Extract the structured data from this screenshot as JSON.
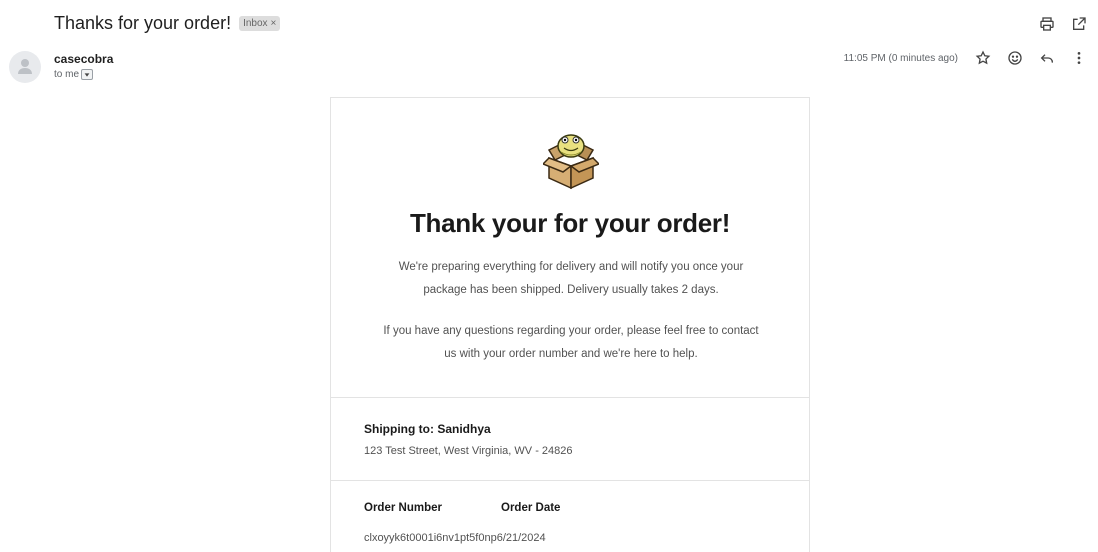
{
  "email": {
    "subject": "Thanks for your order!",
    "label": "Inbox",
    "label_close": "×",
    "sender": "casecobra",
    "recipient": "to me",
    "timestamp": "11:05 PM (0 minutes ago)"
  },
  "icons": {
    "top": [
      "print-icon",
      "open-in-new-window-icon"
    ],
    "meta": [
      "star-icon",
      "emoji-reaction-icon",
      "reply-icon",
      "more-vert-icon"
    ]
  },
  "body": {
    "title": "Thank your for your order!",
    "paragraph1": "We're preparing everything for delivery and will notify you once your package has been shipped. Delivery usually takes 2 days.",
    "paragraph2": "If you have any questions regarding your order, please feel free to contact us with your order number and we're here to help.",
    "shipping_title": "Shipping to: Sanidhya",
    "shipping_address": "123 Test Street, West Virginia, WV - 24826",
    "order_number_label": "Order Number",
    "order_date_label": "Order Date",
    "order_number": "clxoyyk6t0001i6nv1pt5f0np",
    "order_date": "6/21/2024"
  }
}
